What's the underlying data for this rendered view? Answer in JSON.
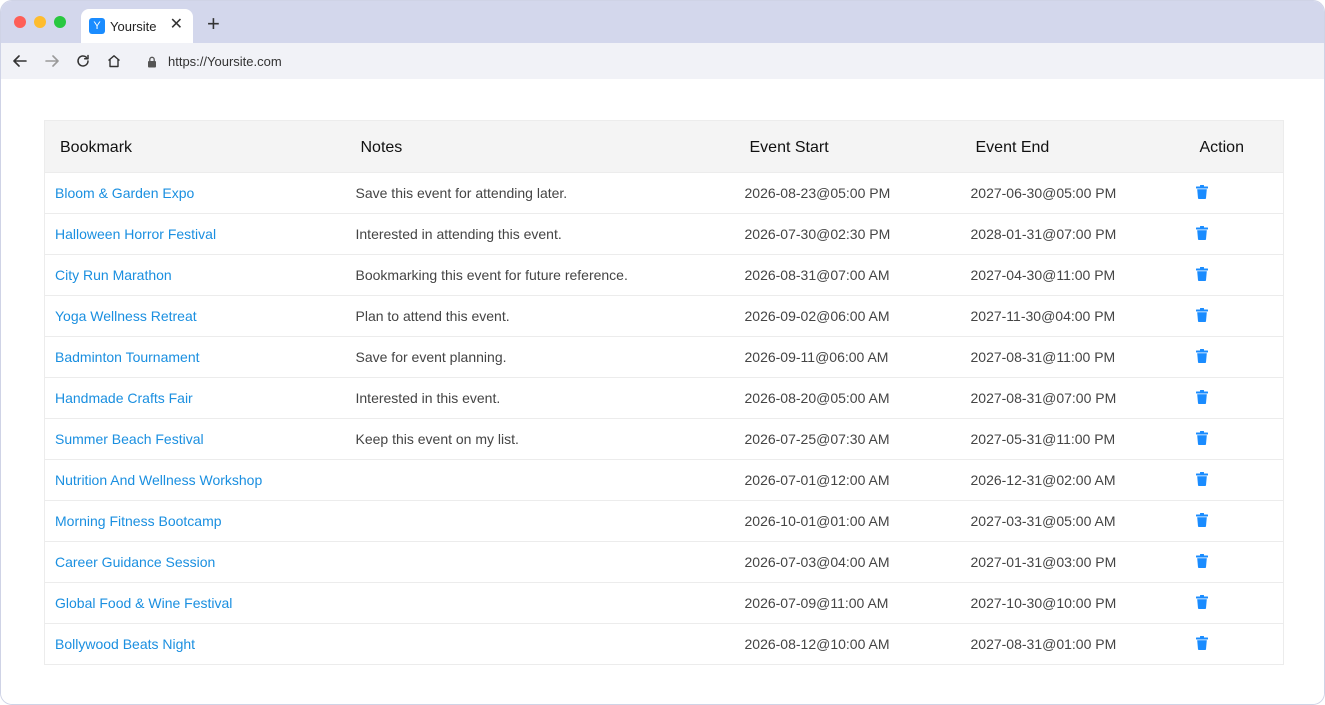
{
  "browser": {
    "tab_title": "Yoursite",
    "favicon_letter": "Y",
    "close_glyph": "✕",
    "new_tab_glyph": "+",
    "url": "https://Yoursite.com"
  },
  "colors": {
    "link": "#1a8fe0",
    "trash": "#1a8cff",
    "header_bg": "#f4f4f4",
    "tabstrip_bg": "#d3d7ec"
  },
  "table": {
    "headers": [
      "Bookmark",
      "Notes",
      "Event Start",
      "Event End",
      "Action"
    ],
    "rows": [
      {
        "bookmark": "Bloom & Garden Expo",
        "notes": "Save this event for attending later.",
        "start": "2026-08-23@05:00 PM",
        "end": "2027-06-30@05:00 PM"
      },
      {
        "bookmark": "Halloween Horror Festival",
        "notes": "Interested in attending this event.",
        "start": "2026-07-30@02:30 PM",
        "end": "2028-01-31@07:00 PM"
      },
      {
        "bookmark": "City Run Marathon",
        "notes": "Bookmarking this event for future reference.",
        "start": "2026-08-31@07:00 AM",
        "end": "2027-04-30@11:00 PM"
      },
      {
        "bookmark": "Yoga Wellness Retreat",
        "notes": "Plan to attend this event.",
        "start": "2026-09-02@06:00 AM",
        "end": "2027-11-30@04:00 PM"
      },
      {
        "bookmark": "Badminton Tournament",
        "notes": "Save for event planning.",
        "start": "2026-09-11@06:00 AM",
        "end": "2027-08-31@11:00 PM"
      },
      {
        "bookmark": "Handmade Crafts Fair",
        "notes": "Interested in this event.",
        "start": "2026-08-20@05:00 AM",
        "end": "2027-08-31@07:00 PM"
      },
      {
        "bookmark": "Summer Beach Festival",
        "notes": "Keep this event on my list.",
        "start": "2026-07-25@07:30 AM",
        "end": "2027-05-31@11:00 PM"
      },
      {
        "bookmark": "Nutrition And Wellness Workshop",
        "notes": "",
        "start": "2026-07-01@12:00 AM",
        "end": "2026-12-31@02:00 AM"
      },
      {
        "bookmark": "Morning Fitness Bootcamp",
        "notes": "",
        "start": "2026-10-01@01:00 AM",
        "end": "2027-03-31@05:00 AM"
      },
      {
        "bookmark": "Career Guidance Session",
        "notes": "",
        "start": "2026-07-03@04:00 AM",
        "end": "2027-01-31@03:00 PM"
      },
      {
        "bookmark": "Global Food & Wine Festival",
        "notes": "",
        "start": "2026-07-09@11:00 AM",
        "end": "2027-10-30@10:00 PM"
      },
      {
        "bookmark": "Bollywood Beats Night",
        "notes": "",
        "start": "2026-08-12@10:00 AM",
        "end": "2027-08-31@01:00 PM"
      }
    ]
  }
}
